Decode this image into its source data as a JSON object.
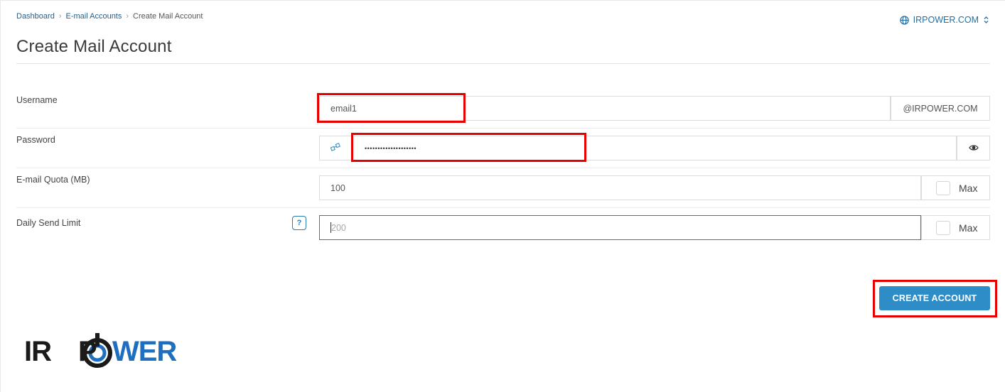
{
  "breadcrumb": {
    "items": [
      "Dashboard",
      "E-mail Accounts"
    ],
    "current": "Create Mail Account"
  },
  "domain_selector": {
    "label": "IRPOWER.COM",
    "icon": "globe-icon",
    "chevron_icon": "chevron-updown-icon"
  },
  "page": {
    "title": "Create Mail Account"
  },
  "form": {
    "username": {
      "label": "Username",
      "value": "email1",
      "suffix": "@IRPOWER.COM"
    },
    "password": {
      "label": "Password",
      "value": "••••••••••••••••••••",
      "generate_icon": "key-generate-icon",
      "toggle_icon": "eye-icon"
    },
    "quota": {
      "label": "E-mail Quota (MB)",
      "value": "100",
      "max_label": "Max"
    },
    "send_limit": {
      "label": "Daily Send Limit",
      "help": "?",
      "placeholder": "200",
      "max_label": "Max"
    }
  },
  "actions": {
    "create_label": "CREATE ACCOUNT"
  },
  "logo": {
    "text": "IRPOWER"
  },
  "colors": {
    "accent": "#2e8dc7",
    "link": "#1f5f8f",
    "highlight": "#e60000"
  }
}
